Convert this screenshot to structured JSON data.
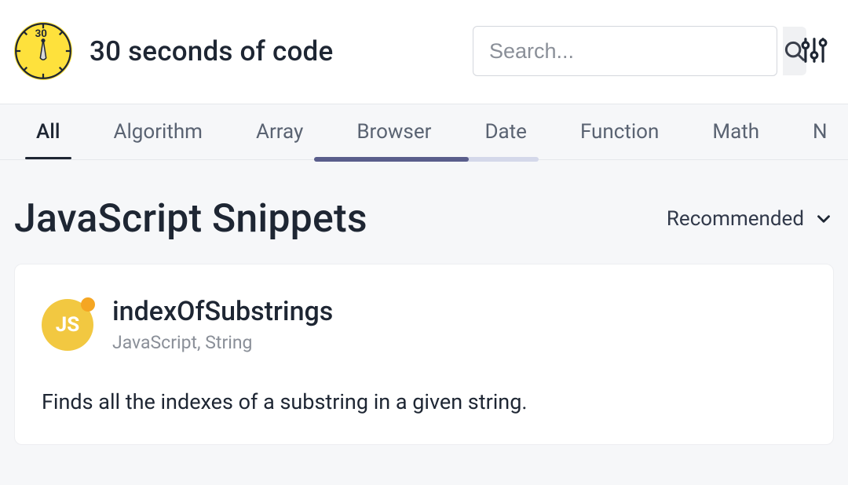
{
  "site": {
    "title": "30 seconds of code",
    "logo_text": "30"
  },
  "search": {
    "placeholder": "Search...",
    "value": ""
  },
  "tabs": {
    "items": [
      "All",
      "Algorithm",
      "Array",
      "Browser",
      "Date",
      "Function",
      "Math",
      "N"
    ],
    "active_index": 0
  },
  "page": {
    "title": "JavaScript Snippets"
  },
  "sort": {
    "selected": "Recommended"
  },
  "snippet": {
    "badge_text": "JS",
    "title": "indexOfSubstrings",
    "tags": "JavaScript, String",
    "description": "Finds all the indexes of a substring in a given string."
  },
  "icons": {
    "search": "search-icon",
    "settings": "settings-icon",
    "chevron": "chevron-down-icon"
  },
  "colors": {
    "accent": "#fee13c",
    "js_badge": "#f2c841",
    "dot": "#f5a623",
    "scroll_thumb": "#5a5e8c"
  }
}
